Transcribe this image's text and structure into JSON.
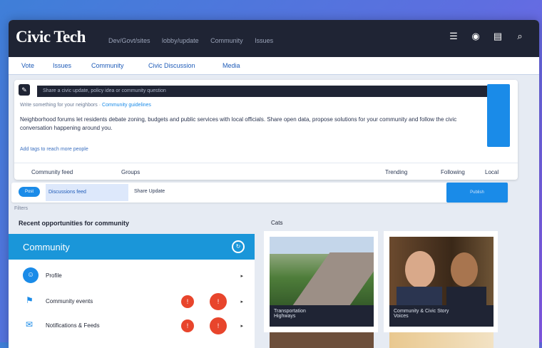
{
  "brand": "Civic Tech",
  "topnav": [
    "Dev/Govt/sites",
    "lobby/update",
    "Community",
    "Issues"
  ],
  "topicons": [
    "menu-icon",
    "user-icon",
    "chat-icon",
    "search-icon"
  ],
  "subnav": [
    "Vote",
    "Issues",
    "Community",
    "Civic Discussion",
    "Media"
  ],
  "composer": {
    "bar": "Share a civic update, policy idea or community question",
    "hint": "Write something for your neighbors",
    "hint_link": "Community guidelines",
    "body": "Neighborhood forums let residents debate zoning, budgets and public services with local officials. Share open data, propose solutions for your community and follow the civic conversation happening around you.",
    "chip": "Add tags to reach more people",
    "foot_left": "Community feed",
    "foot_mid": "Groups",
    "foot_r1": "Trending",
    "foot_r2": "Following",
    "foot_r3": "Local"
  },
  "sharebar": {
    "pill": "Post",
    "tab": "Discussions feed",
    "text": "Share Update",
    "button": "Publish"
  },
  "tiny": "Filters",
  "section_title": "Recent opportunities for community",
  "cats_label": "Cats",
  "sidebar": {
    "title": "Community",
    "rows": [
      "Profile",
      "Community events",
      "Notifications & Feeds"
    ]
  },
  "cards": [
    {
      "caption1": "Transportation",
      "caption2": "Highways"
    },
    {
      "caption1": "Community & Civic Story",
      "caption2": "Voices"
    }
  ],
  "colors": {
    "accent": "#1a8be8",
    "header": "#1f2434",
    "alert": "#e8452c"
  }
}
